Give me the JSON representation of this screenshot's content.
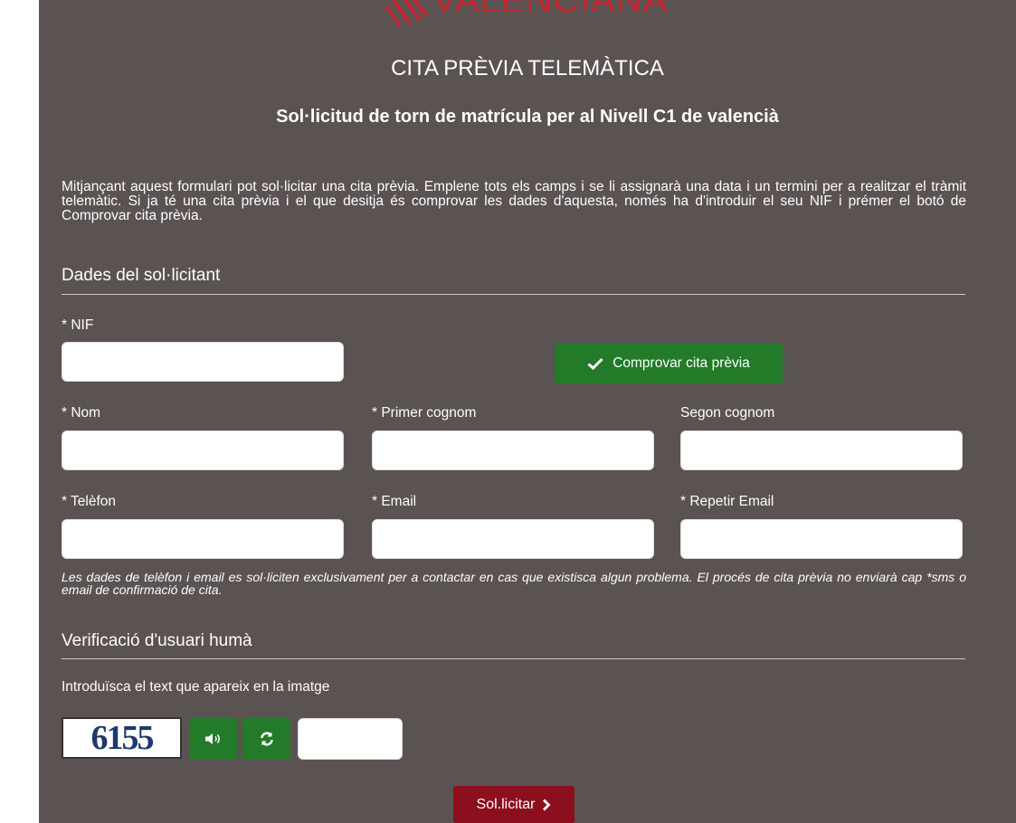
{
  "header": {
    "logo_text": "VALENCIANA",
    "title": "CITA PRÈVIA TELEMÀTICA",
    "subtitle": "Sol·licitud de torn de matrícula per al Nivell C1 de valencià"
  },
  "intro": "Mitjançant aquest formulari pot sol·licitar una cita prèvia. Emplene tots els camps i se li assignarà una data i un termini per a realitzar el tràmit telemàtic. Si ja té una cita prèvia i el que desitja és comprovar les dades d'aquesta, només ha d'introduir el seu NIF i prémer el botó de Comprovar cita prèvia.",
  "applicant_section": {
    "heading": "Dades del sol·licitant",
    "nif_label": "* NIF",
    "nif_value": "",
    "check_button": "Comprovar cita prèvia",
    "name_label": "* Nom",
    "name_value": "",
    "surname1_label": "* Primer cognom",
    "surname1_value": "",
    "surname2_label": "Segon cognom",
    "surname2_value": "",
    "phone_label": "* Telèfon",
    "phone_value": "",
    "email_label": "* Email",
    "email_value": "",
    "email_repeat_label": "* Repetir Email",
    "email_repeat_value": "",
    "note": "Les dades de telèfon i email es sol·liciten exclusivament per a contactar en cas que existisca algun problema. El procés de cita prèvia no enviarà cap *sms o email de confirmació de cita."
  },
  "captcha_section": {
    "heading": "Verificació d'usuari humà",
    "instruction": "Introduïsca el text que apareix en la imatge",
    "captcha_text": "6155",
    "audio_icon": "volume-icon",
    "refresh_icon": "refresh-icon",
    "input_value": ""
  },
  "submit_label": "Sol.licitar",
  "colors": {
    "panel_bg": "#5a5352",
    "green": "#237b2a",
    "submit_red": "#8b0f1c",
    "logo_red": "#c2262e"
  }
}
